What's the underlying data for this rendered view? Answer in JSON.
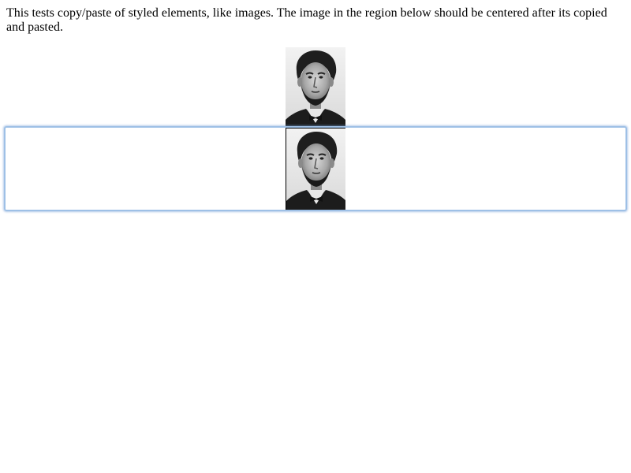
{
  "instructions": {
    "text": "This tests copy/paste of styled elements, like images. The image in the region below should be centered after its copied and pasted."
  },
  "source_image": {
    "icon": "portrait-photo-icon",
    "alt": ""
  },
  "editable_region": {
    "focus_color": "#9ec0e6",
    "pasted_image": {
      "icon": "portrait-photo-icon",
      "alt": ""
    }
  }
}
